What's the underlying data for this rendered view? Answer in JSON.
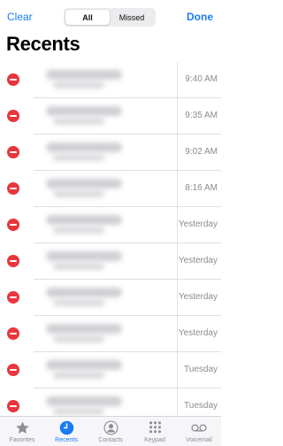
{
  "nav": {
    "clear_label": "Clear",
    "done_label": "Done",
    "segments": [
      {
        "label": "All",
        "selected": true
      },
      {
        "label": "Missed",
        "selected": false
      }
    ]
  },
  "page_title": "Recents",
  "calls": [
    {
      "time": "9:40 AM"
    },
    {
      "time": "9:35 AM"
    },
    {
      "time": "9:02 AM"
    },
    {
      "time": "8:16 AM"
    },
    {
      "time": "Yesterday"
    },
    {
      "time": "Yesterday"
    },
    {
      "time": "Yesterday"
    },
    {
      "time": "Yesterday"
    },
    {
      "time": "Tuesday"
    },
    {
      "time": "Tuesday"
    }
  ],
  "tabbar": {
    "items": [
      {
        "label": "Favorites",
        "icon": "star-icon",
        "active": false
      },
      {
        "label": "Recents",
        "icon": "clock-icon",
        "active": true
      },
      {
        "label": "Contacts",
        "icon": "person-circle-icon",
        "active": false
      },
      {
        "label": "Keypad",
        "icon": "keypad-icon",
        "active": false
      },
      {
        "label": "Voicemail",
        "icon": "voicemail-icon",
        "active": false
      }
    ]
  },
  "colors": {
    "accent": "#1a7cf5",
    "delete": "#e8363d",
    "secondary_text": "#8c8c92"
  }
}
